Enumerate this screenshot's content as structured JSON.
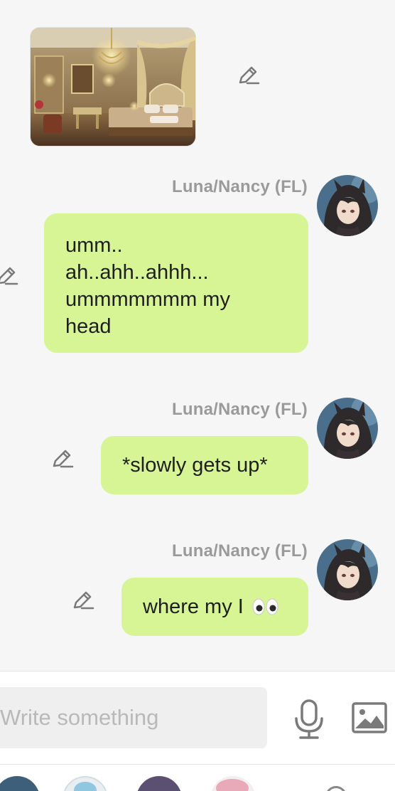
{
  "chat": {
    "scene_image_alt": "Ornate bedroom with canopy bed and chandelier",
    "messages": [
      {
        "sender": "Luna/Nancy (FL)",
        "lines": [
          "umm..",
          "ah..ahh..ahhh...",
          "ummmmmmm my",
          "head"
        ]
      },
      {
        "sender": "Luna/Nancy (FL)",
        "text": "*slowly gets up*"
      },
      {
        "sender": "Luna/Nancy (FL)",
        "text": "where my I"
      }
    ]
  },
  "composer": {
    "placeholder": "Write something",
    "value": ""
  },
  "icons": {
    "edit": "pencil-edit-icon",
    "mic": "microphone-icon",
    "image": "image-upload-icon",
    "emoji": "eyes-emoji"
  },
  "colors": {
    "bubble": "#d7f595",
    "background": "#f6f6f7",
    "sender_name": "#9a9a9a",
    "icon": "#7a7a7a"
  }
}
